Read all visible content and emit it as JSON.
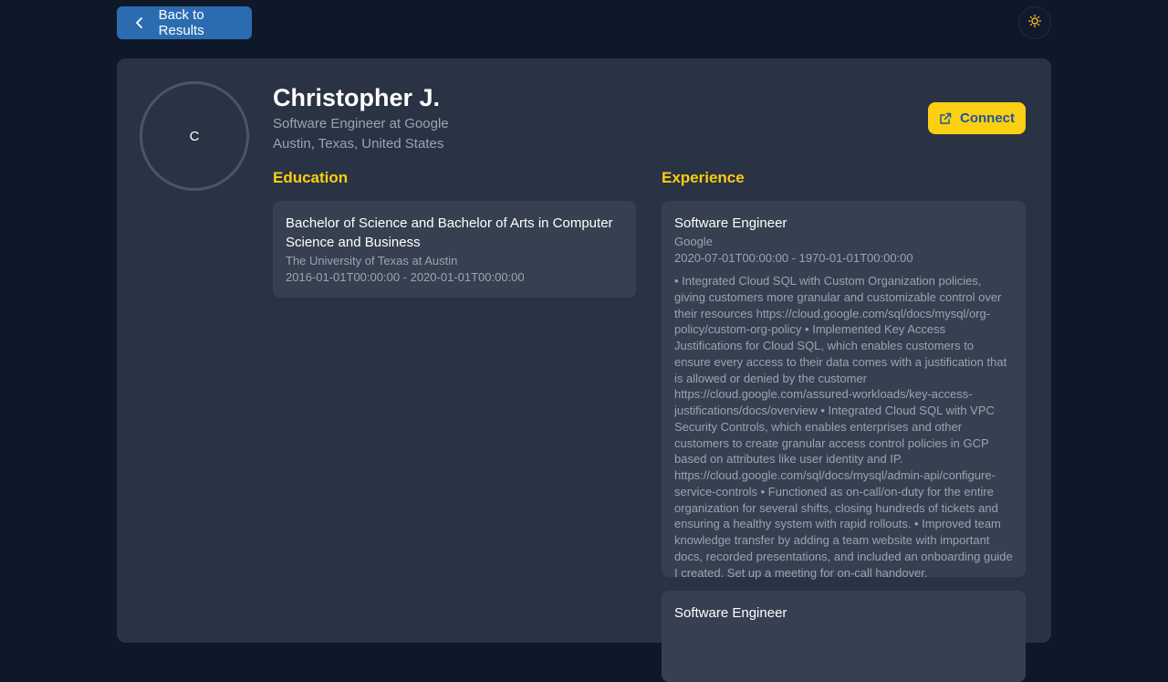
{
  "nav": {
    "back_label": "Back to Results",
    "back_icon": "chevron-left-icon",
    "theme_icon": "sun-icon"
  },
  "profile": {
    "avatar_initial": "C",
    "name": "Christopher J.",
    "headline": "Software Engineer at Google",
    "location": "Austin, Texas, United States",
    "connect_label": "Connect",
    "connect_icon": "external-link-icon"
  },
  "education": {
    "title": "Education",
    "items": [
      {
        "degree": "Bachelor of Science and Bachelor of Arts in Computer Science and Business",
        "school": "The University of Texas at Austin",
        "dates": "2016-01-01T00:00:00 - 2020-01-01T00:00:00"
      }
    ]
  },
  "experience": {
    "title": "Experience",
    "items": [
      {
        "role": "Software Engineer",
        "company": "Google",
        "dates": "2020-07-01T00:00:00 - 1970-01-01T00:00:00",
        "description": "• Integrated Cloud SQL with Custom Organization policies, giving customers more granular and customizable control over their resources https://cloud.google.com/sql/docs/mysql/org-policy/custom-org-policy • Implemented Key Access Justifications for Cloud SQL, which enables customers to ensure every access to their data comes with a justification that is allowed or denied by the customer https://cloud.google.com/assured-workloads/key-access-justifications/docs/overview • Integrated Cloud SQL with VPC Security Controls, which enables enterprises and other customers to create granular access control policies in GCP based on attributes like user identity and IP. https://cloud.google.com/sql/docs/mysql/admin-api/configure-service-controls • Functioned as on-call/on-duty for the entire organization for several shifts, closing hundreds of tickets and ensuring a healthy system with rapid rollouts. • Improved team knowledge transfer by adding a team website with important docs, recorded presentations, and included an onboarding guide I created. Set up a meeting for on-call handover."
      },
      {
        "role": "Software Engineer"
      }
    ]
  },
  "colors": {
    "accent": "#facc15",
    "primary": "#2b6cb0",
    "background": "#0f1829",
    "card": "#2a3343"
  }
}
